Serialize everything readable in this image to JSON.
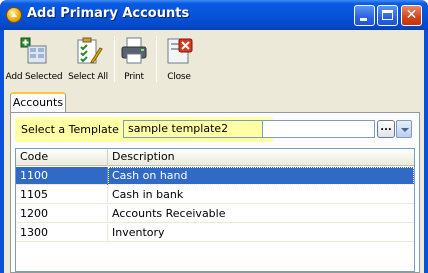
{
  "window": {
    "title": "Add Primary Accounts",
    "controls": {
      "minimize": "minimize-icon",
      "maximize": "maximize-icon",
      "close": "close-icon"
    }
  },
  "toolbar": {
    "buttons": [
      {
        "label": "Add Selected",
        "icon": "add-selected-icon"
      },
      {
        "label": "Select All",
        "icon": "select-all-icon"
      },
      {
        "label": "Print",
        "icon": "printer-icon"
      },
      {
        "label": "Close",
        "icon": "close-icon"
      }
    ]
  },
  "tabs": [
    {
      "label": "Accounts",
      "active": true
    }
  ],
  "template": {
    "label": "Select a Template",
    "value": "sample template2",
    "ellipsis": "...",
    "highlight_color": "#ffff9c"
  },
  "grid": {
    "columns": [
      "Code",
      "Description"
    ],
    "rows": [
      {
        "code": "1100",
        "description": "Cash on hand",
        "selected": true
      },
      {
        "code": "1105",
        "description": "Cash in bank",
        "selected": false
      },
      {
        "code": "1200",
        "description": "Accounts Receivable",
        "selected": false
      },
      {
        "code": "1300",
        "description": "Inventory",
        "selected": false
      }
    ],
    "selection_color": "#316ac5"
  },
  "colors": {
    "titlebar": "#0653d8",
    "face": "#ece9d8",
    "tab_accent": "#ffc83c"
  }
}
